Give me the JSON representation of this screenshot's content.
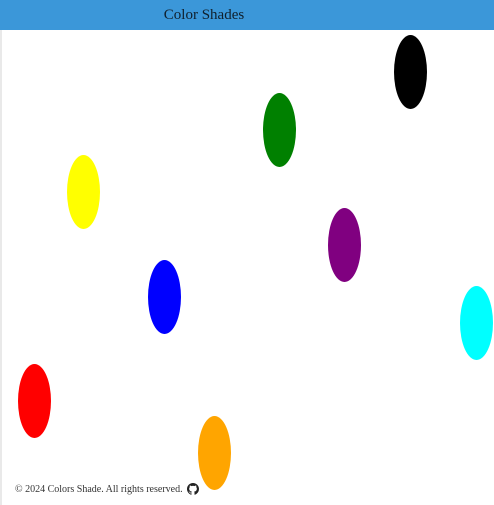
{
  "header": {
    "title": "Color Shades",
    "background": "#3b97d9"
  },
  "blobs": [
    {
      "name": "black",
      "color": "#000000"
    },
    {
      "name": "green",
      "color": "#008000"
    },
    {
      "name": "yellow",
      "color": "#ffff00"
    },
    {
      "name": "purple",
      "color": "#800080"
    },
    {
      "name": "blue",
      "color": "#0000ff"
    },
    {
      "name": "cyan",
      "color": "#00ffff"
    },
    {
      "name": "red",
      "color": "#ff0000"
    },
    {
      "name": "orange",
      "color": "#ffa500"
    }
  ],
  "footer": {
    "copyright": "© 2024 Colors Shade. All rights reserved.",
    "icon": "github-icon"
  }
}
